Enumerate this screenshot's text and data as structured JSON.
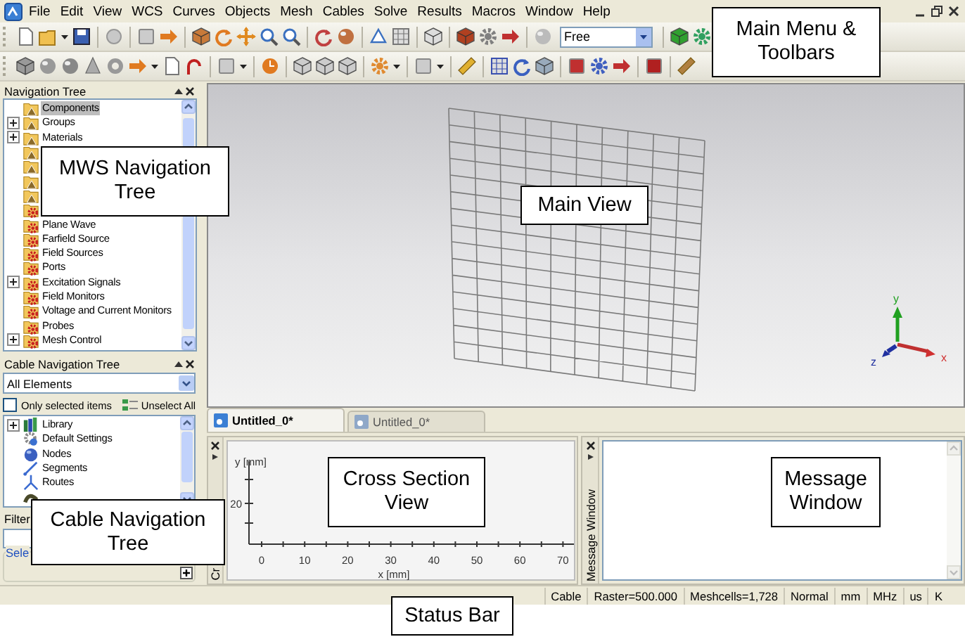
{
  "menu_bar": {
    "items": [
      "File",
      "Edit",
      "View",
      "WCS",
      "Curves",
      "Objects",
      "Mesh",
      "Cables",
      "Solve",
      "Results",
      "Macros",
      "Window",
      "Help"
    ]
  },
  "toolbar": {
    "mode_combo": {
      "value": "Free"
    }
  },
  "navigation_tree": {
    "title": "Navigation Tree",
    "items": [
      {
        "label": "Components",
        "kind": "component",
        "collapsed": false,
        "selected": true
      },
      {
        "label": "Groups",
        "kind": "component",
        "collapsed": true,
        "selected": false
      },
      {
        "label": "Materials",
        "kind": "component",
        "collapsed": true,
        "selected": false
      },
      {
        "kind": "component",
        "collapsed": false,
        "selected": false
      },
      {
        "kind": "component",
        "collapsed": false,
        "selected": false
      },
      {
        "kind": "component",
        "collapsed": false,
        "selected": false
      },
      {
        "kind": "component",
        "collapsed": false,
        "selected": false
      },
      {
        "kind": "source",
        "collapsed": false,
        "selected": false
      },
      {
        "label": "Plane Wave",
        "kind": "source",
        "collapsed": false,
        "selected": false
      },
      {
        "label": "Farfield Source",
        "kind": "source",
        "collapsed": false,
        "selected": false
      },
      {
        "label": "Field Sources",
        "kind": "source",
        "collapsed": false,
        "selected": false
      },
      {
        "label": "Ports",
        "kind": "source",
        "collapsed": false,
        "selected": false
      },
      {
        "label": "Excitation Signals",
        "kind": "source",
        "collapsed": true,
        "selected": false
      },
      {
        "label": "Field Monitors",
        "kind": "source",
        "collapsed": false,
        "selected": false
      },
      {
        "label": "Voltage and Current Monitors",
        "kind": "source",
        "collapsed": false,
        "selected": false
      },
      {
        "label": "Probes",
        "kind": "source",
        "collapsed": false,
        "selected": false
      },
      {
        "label": "Mesh Control",
        "kind": "source",
        "collapsed": true,
        "selected": false
      }
    ]
  },
  "cable_navigation_tree": {
    "title": "Cable Navigation Tree",
    "filter_combo": {
      "value": "All Elements"
    },
    "only_selected": {
      "label": "Only selected items",
      "checked": false
    },
    "unselect_all": {
      "label": "Unselect All"
    },
    "items": [
      {
        "label": "Library",
        "kind": "library",
        "collapsed": true,
        "selected": false
      },
      {
        "label": "Default Settings",
        "kind": "settings",
        "collapsed": false,
        "selected": false
      },
      {
        "label": "Nodes",
        "kind": "node",
        "collapsed": false,
        "selected": false
      },
      {
        "label": "Segments",
        "kind": "segment",
        "collapsed": false,
        "selected": false
      },
      {
        "label": "Routes",
        "kind": "route",
        "collapsed": false,
        "selected": false
      },
      {
        "kind": "cable",
        "collapsed": false,
        "selected": false
      }
    ],
    "filter_label": "Filter",
    "selection_group": "Sele"
  },
  "main_view": {
    "axes": {
      "x": "x",
      "y": "y",
      "z": "z"
    }
  },
  "document_tabs": [
    {
      "label": "Untitled_0*",
      "selected": true
    },
    {
      "label": "Untitled_0*",
      "selected": false
    }
  ],
  "cross_section": {
    "side_label": "Cr",
    "y_label": "y [mm]",
    "y_ticks": [
      "20"
    ],
    "x_ticks": [
      "0",
      "10",
      "20",
      "30",
      "40",
      "50",
      "60",
      "70"
    ],
    "x_label": "x [mm]"
  },
  "message_window": {
    "side_label": "Message Window"
  },
  "status_bar": {
    "items": [
      "Cable",
      "Raster=500.000",
      "Meshcells=1,728",
      "Normal",
      "mm",
      "MHz",
      "us",
      "K"
    ]
  },
  "annotations": [
    {
      "text": "Main Menu & Toolbars"
    },
    {
      "text": "MWS Navigation Tree"
    },
    {
      "text": "Main View"
    },
    {
      "text": "Cross Section View"
    },
    {
      "text": "Message Window"
    },
    {
      "text": "Cable Navigation Tree"
    },
    {
      "text": "Status Bar"
    }
  ]
}
